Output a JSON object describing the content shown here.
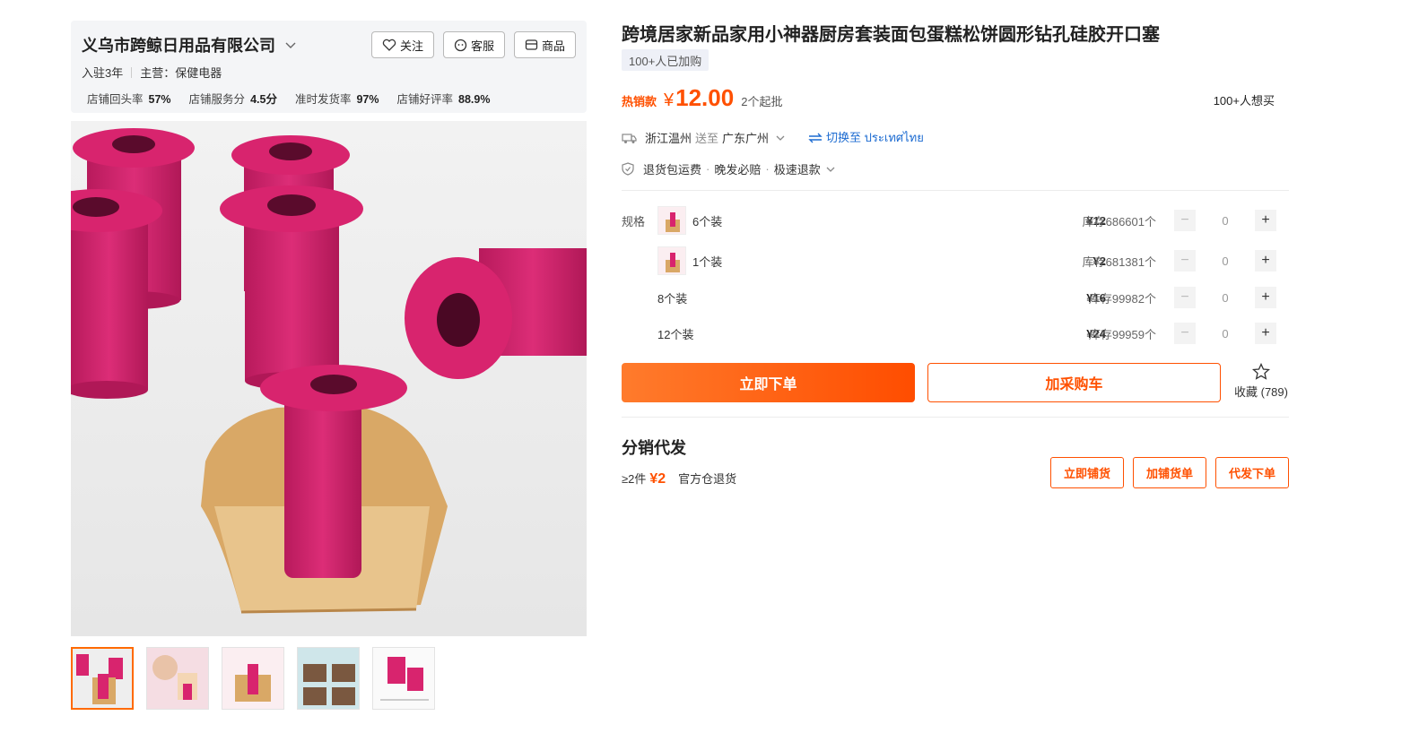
{
  "shop": {
    "name": "义乌市跨鲸日用品有限公司",
    "buttons": {
      "follow": "关注",
      "service": "客服",
      "goods": "商品"
    },
    "years": "入驻3年",
    "main_business": "主营：保健电器",
    "stats": [
      {
        "label": "店铺回头率",
        "value": "57%"
      },
      {
        "label": "店铺服务分",
        "value": "4.5分"
      },
      {
        "label": "准时发货率",
        "value": "97%"
      },
      {
        "label": "店铺好评率",
        "value": "88.9%"
      }
    ]
  },
  "product": {
    "title": "跨境居家新品家用小神器厨房套装面包蛋糕松饼圆形钻孔硅胶开口塞",
    "join_badge": "100+人已加购",
    "hot_tag": "热销款",
    "price_symbol": "¥",
    "price": "12.00",
    "min_order": "2个起批",
    "wants": "100+人想买",
    "ship_from": "浙江温州",
    "ship_word": "送至",
    "ship_to": "广东广州",
    "switch_text": "切换至 ประเทศไทย",
    "guarantees": [
      "退货包运费",
      "晚发必赔",
      "极速退款"
    ],
    "spec_label": "规格",
    "specs": [
      {
        "name": "6个装",
        "price": "¥12",
        "stock": "库存686601个",
        "qty": "0",
        "has_thumb": true
      },
      {
        "name": "1个装",
        "price": "¥2",
        "stock": "库存681381个",
        "qty": "0",
        "has_thumb": true
      },
      {
        "name": "8个装",
        "price": "¥16",
        "stock": "库存99982个",
        "qty": "0",
        "has_thumb": false
      },
      {
        "name": "12个装",
        "price": "¥24",
        "stock": "库存99959个",
        "qty": "0",
        "has_thumb": false
      }
    ],
    "order_button": "立即下单",
    "cart_button": "加采购车",
    "fav_label": "收藏 (789)"
  },
  "distribution": {
    "title": "分销代发",
    "min_qty": "≥2件",
    "price": "¥2",
    "note": "官方仓退货",
    "buttons": [
      "立即铺货",
      "加铺货单",
      "代发下单"
    ]
  },
  "colors": {
    "accent": "#ff5000",
    "product_pink": "#d8246e",
    "link": "#1c6bd1"
  }
}
